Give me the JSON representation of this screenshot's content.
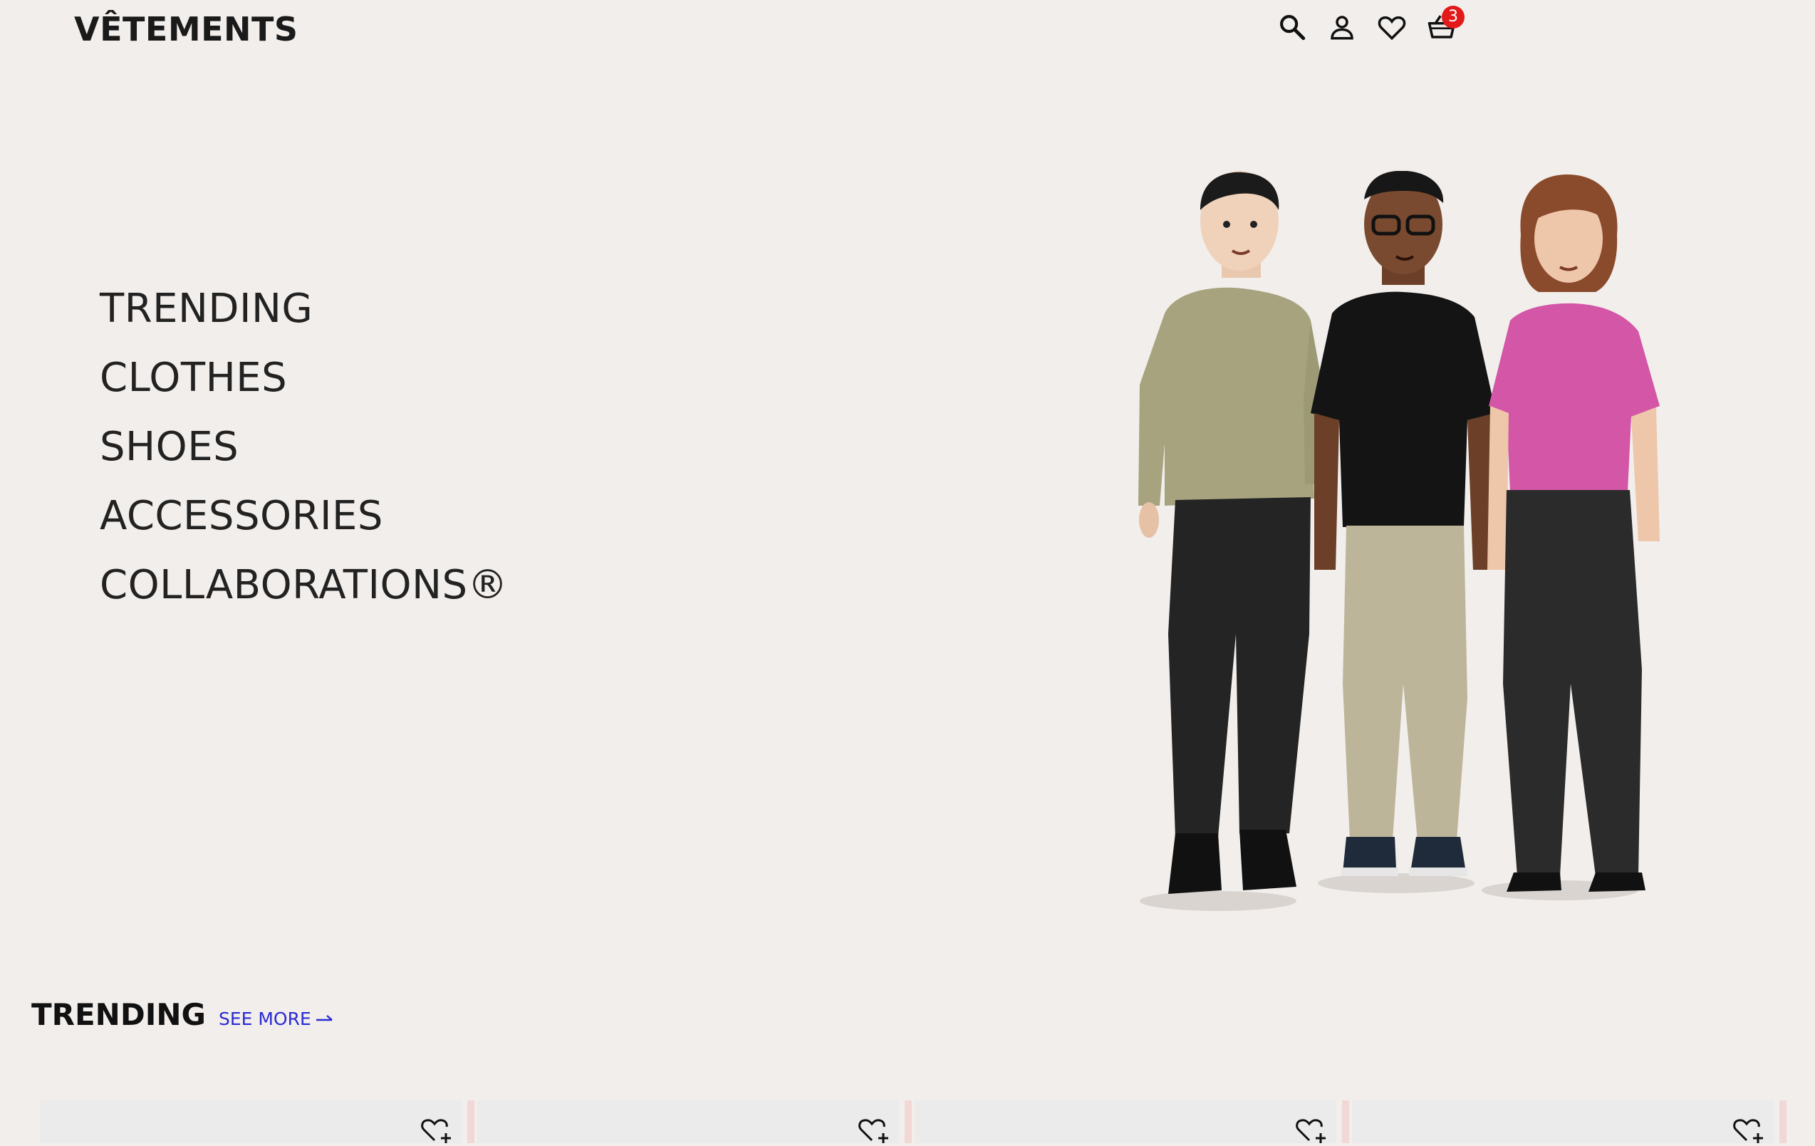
{
  "header": {
    "logo": "VÊTEMENTS",
    "icons": [
      "search-icon",
      "user-icon",
      "heart-icon",
      "basket-icon"
    ],
    "cart_count": "3"
  },
  "menu": {
    "items": [
      "TRENDING",
      "CLOTHES",
      "SHOES",
      "ACCESSORIES",
      "COLLABORATIONS®"
    ]
  },
  "trending": {
    "title": "TRENDING",
    "see_more": "SEE MORE"
  },
  "colors": {
    "background": "#f2eeeb",
    "accent_link": "#2b2bd6",
    "badge": "#e21a1a"
  }
}
